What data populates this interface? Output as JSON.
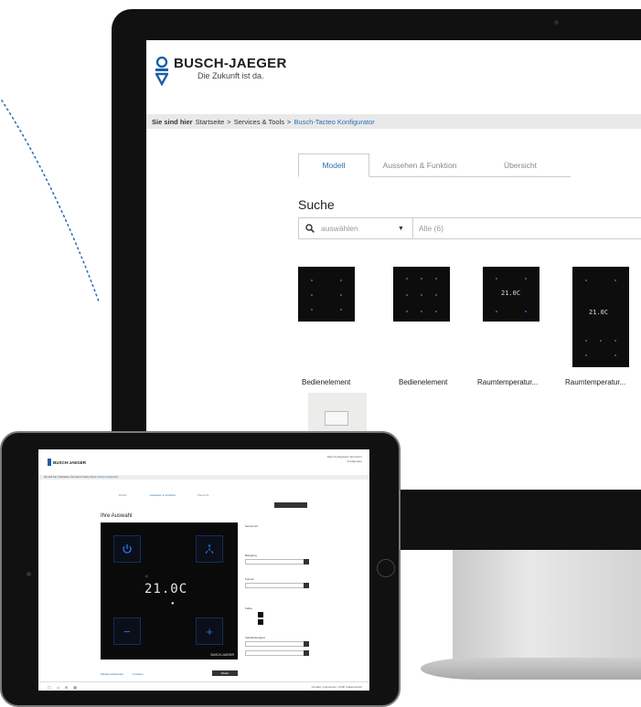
{
  "monitor": {
    "brand": "BUSCH-JAEGER",
    "slogan": "Die Zukunft ist da.",
    "breadcrumb": {
      "lead": "Sie sind hier",
      "items": [
        "Startseite",
        "Services & Tools",
        "Busch-Tacteo Konfigurator"
      ],
      "separator": ">"
    },
    "tabs": [
      "Modell",
      "Aussehen & Funktion",
      "Übersicht"
    ],
    "search_title": "Suche",
    "select_placeholder": "auswählen",
    "all_label": "Alle (6)",
    "products": [
      {
        "label": "Bedienelement",
        "display": ""
      },
      {
        "label": "Bedienelement",
        "display": ""
      },
      {
        "label": "Raumtemperatur...",
        "display": "21.0C"
      },
      {
        "label": "Raumtemperatur...",
        "display": "21.0C"
      }
    ]
  },
  "tablet": {
    "brand": "BUSCH-JAEGER",
    "top_right": [
      "Mein Konfigurator",
      "Speichern",
      "Konfigurator"
    ],
    "breadcrumb": {
      "items": [
        "Sie sind hier",
        "Startseite",
        "Services & Tools"
      ],
      "active": "Busch-Tacteo Konfigurator"
    },
    "tabs": [
      "Modell",
      "Aussehen & Funktion",
      "Übersicht"
    ],
    "title": "Ihre Auswahl",
    "temperature": "21.0C",
    "panel_brand": "BUSCH-JAEGER",
    "links": [
      "Modell ausblenden",
      "Funktion"
    ],
    "next_button": "Weiter",
    "side_labels": [
      "Sensor Art",
      "Belegung",
      "Format",
      "Farbe",
      "Verkabelungsart"
    ],
    "footer_links": [
      "Kontakt",
      "Impressum",
      "AGB",
      "Datenschutz"
    ],
    "footer_icons": [
      "printer-icon",
      "share-icon",
      "mail-icon",
      "grid-icon"
    ]
  },
  "colors": {
    "accent_blue": "#2d6fb3",
    "led_blue": "#2c6fe0",
    "panel_black": "#0a0a0a"
  }
}
